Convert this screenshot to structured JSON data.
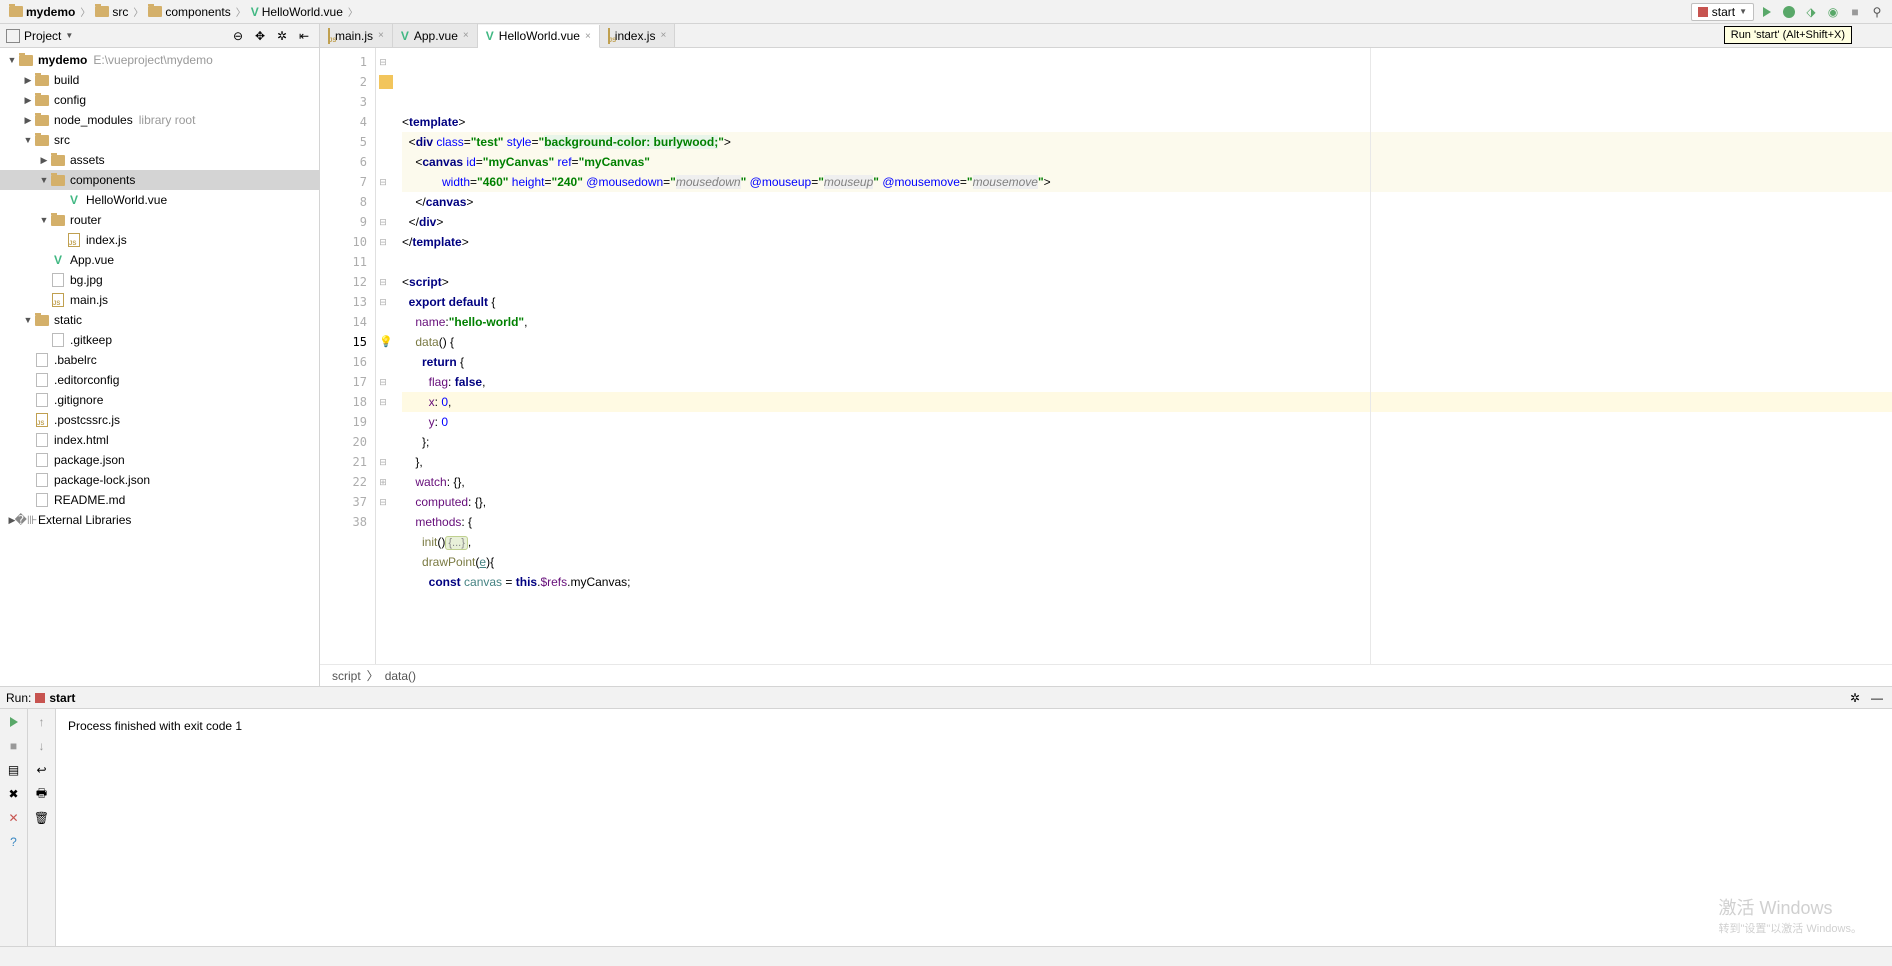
{
  "breadcrumb": {
    "items": [
      {
        "label": "mydemo",
        "bold": true,
        "icon": "folder"
      },
      {
        "label": "src",
        "icon": "folder"
      },
      {
        "label": "components",
        "icon": "folder"
      },
      {
        "label": "HelloWorld.vue",
        "icon": "vue"
      }
    ]
  },
  "toolbar": {
    "run_config": "start",
    "tooltip": "Run 'start' (Alt+Shift+X)"
  },
  "project_panel": {
    "title": "Project",
    "tree": [
      {
        "depth": 0,
        "arrow": "▼",
        "icon": "folder",
        "label": "mydemo",
        "bold": true,
        "hint": "E:\\vueproject\\mydemo"
      },
      {
        "depth": 1,
        "arrow": "▶",
        "icon": "folder",
        "label": "build"
      },
      {
        "depth": 1,
        "arrow": "▶",
        "icon": "folder",
        "label": "config"
      },
      {
        "depth": 1,
        "arrow": "▶",
        "icon": "folder",
        "label": "node_modules",
        "hint": "library root"
      },
      {
        "depth": 1,
        "arrow": "▼",
        "icon": "folder",
        "label": "src"
      },
      {
        "depth": 2,
        "arrow": "▶",
        "icon": "folder",
        "label": "assets"
      },
      {
        "depth": 2,
        "arrow": "▼",
        "icon": "folder",
        "label": "components",
        "selected": true
      },
      {
        "depth": 3,
        "arrow": "",
        "icon": "vue",
        "label": "HelloWorld.vue"
      },
      {
        "depth": 2,
        "arrow": "▼",
        "icon": "folder",
        "label": "router"
      },
      {
        "depth": 3,
        "arrow": "",
        "icon": "js",
        "label": "index.js"
      },
      {
        "depth": 2,
        "arrow": "",
        "icon": "vue",
        "label": "App.vue"
      },
      {
        "depth": 2,
        "arrow": "",
        "icon": "img",
        "label": "bg.jpg"
      },
      {
        "depth": 2,
        "arrow": "",
        "icon": "js",
        "label": "main.js"
      },
      {
        "depth": 1,
        "arrow": "▼",
        "icon": "folder",
        "label": "static"
      },
      {
        "depth": 2,
        "arrow": "",
        "icon": "file",
        "label": ".gitkeep"
      },
      {
        "depth": 1,
        "arrow": "",
        "icon": "file",
        "label": ".babelrc"
      },
      {
        "depth": 1,
        "arrow": "",
        "icon": "file",
        "label": ".editorconfig"
      },
      {
        "depth": 1,
        "arrow": "",
        "icon": "file",
        "label": ".gitignore"
      },
      {
        "depth": 1,
        "arrow": "",
        "icon": "js",
        "label": ".postcssrc.js"
      },
      {
        "depth": 1,
        "arrow": "",
        "icon": "html",
        "label": "index.html"
      },
      {
        "depth": 1,
        "arrow": "",
        "icon": "json",
        "label": "package.json"
      },
      {
        "depth": 1,
        "arrow": "",
        "icon": "json",
        "label": "package-lock.json"
      },
      {
        "depth": 1,
        "arrow": "",
        "icon": "md",
        "label": "README.md"
      },
      {
        "depth": 0,
        "arrow": "▶",
        "icon": "lib",
        "label": "External Libraries"
      }
    ]
  },
  "tabs": [
    {
      "label": "main.js",
      "icon": "js",
      "active": false
    },
    {
      "label": "App.vue",
      "icon": "vue",
      "active": false
    },
    {
      "label": "HelloWorld.vue",
      "icon": "vue",
      "active": true
    },
    {
      "label": "index.js",
      "icon": "js",
      "active": false
    }
  ],
  "gutter": {
    "lines": [
      1,
      2,
      3,
      4,
      5,
      6,
      7,
      8,
      9,
      10,
      11,
      12,
      13,
      14,
      15,
      16,
      17,
      18,
      19,
      20,
      21,
      22,
      37,
      38
    ],
    "current": 15,
    "bookmark_line": 2,
    "bulb_line": 15
  },
  "code_lines": [
    {
      "n": 1,
      "html": "<span class='op'>&lt;</span><span class='tag'>template</span><span class='op'>&gt;</span>"
    },
    {
      "n": 2,
      "hl": true,
      "html": "  <span class='op'>&lt;</span><span class='tag'>div</span> <span class='attr'>class</span>=<span class='str'>\"test\"</span> <span class='attr'>style</span>=<span class='str'>\"</span><span class='str str-bg'>background-color: burlywood;</span><span class='str'>\"</span><span class='op'>&gt;</span>"
    },
    {
      "n": 3,
      "hl": true,
      "html": "    <span class='op'>&lt;</span><span class='tag'>canvas</span> <span class='attr'>id</span>=<span class='str'>\"myCanvas\"</span> <span class='attr'>ref</span>=<span class='str'>\"myCanvas\"</span>"
    },
    {
      "n": 4,
      "hl": true,
      "html": "            <span class='attr'>width</span>=<span class='str'>\"460\"</span> <span class='attr'>height</span>=<span class='str'>\"240\"</span> <span class='attr'>@mousedown</span>=<span class='str'>\"</span><span class='evt'>mousedown</span><span class='str'>\"</span> <span class='attr'>@mouseup</span>=<span class='str'>\"</span><span class='evt'>mouseup</span><span class='str'>\"</span> <span class='attr'>@mousemove</span>=<span class='str'>\"</span><span class='evt'>mousemove</span><span class='str'>\"</span><span class='op'>&gt;</span>"
    },
    {
      "n": 5,
      "html": "    <span class='op'>&lt;/</span><span class='tag'>canvas</span><span class='op'>&gt;</span>"
    },
    {
      "n": 6,
      "html": "  <span class='op'>&lt;/</span><span class='tag'>div</span><span class='op'>&gt;</span>"
    },
    {
      "n": 7,
      "html": "<span class='op'>&lt;/</span><span class='tag'>template</span><span class='op'>&gt;</span>"
    },
    {
      "n": 8,
      "html": ""
    },
    {
      "n": 9,
      "html": "<span class='op'>&lt;</span><span class='tag'>script</span><span class='op'>&gt;</span>"
    },
    {
      "n": 10,
      "html": "  <span class='kw'>export default</span> {"
    },
    {
      "n": 11,
      "html": "    <span class='prop'>name</span>:<span class='str'>\"hello-world\"</span>,"
    },
    {
      "n": 12,
      "html": "    <span class='fn'>data</span>() {"
    },
    {
      "n": 13,
      "html": "      <span class='kw'>return</span> {"
    },
    {
      "n": 14,
      "html": "        <span class='prop'>flag</span>: <span class='kw'>false</span>,"
    },
    {
      "n": 15,
      "hl_sel": true,
      "html": "        <span class='prop'>x</span>: <span class='num'>0</span>,"
    },
    {
      "n": 16,
      "html": "        <span class='prop'>y</span>: <span class='num'>0</span>"
    },
    {
      "n": 17,
      "html": "      };"
    },
    {
      "n": 18,
      "html": "    },"
    },
    {
      "n": 19,
      "html": "    <span class='prop'>watch</span>: {},"
    },
    {
      "n": 20,
      "html": "    <span class='prop'>computed</span>: {},"
    },
    {
      "n": 21,
      "html": "    <span class='prop'>methods</span>: {"
    },
    {
      "n": 22,
      "html": "      <span class='fn'>init</span>()<span class='folded'>{...}</span>,"
    },
    {
      "n": 37,
      "html": "      <span class='fn'>drawPoint</span>(<span class='param'><u>e</u></span>){"
    },
    {
      "n": 38,
      "html": "        <span class='kw'>const</span> <span class='param'>canvas</span> = <span class='this'>this</span>.<span class='prop'>$refs</span>.myCanvas;"
    }
  ],
  "editor_breadcrumb": {
    "items": [
      "script",
      "data()"
    ]
  },
  "run_panel": {
    "header": {
      "label_run": "Run:",
      "label_config": "start"
    },
    "output": "Process finished with exit code 1"
  },
  "watermark": {
    "line1": "激活 Windows",
    "line2": "转到\"设置\"以激活 Windows。"
  }
}
